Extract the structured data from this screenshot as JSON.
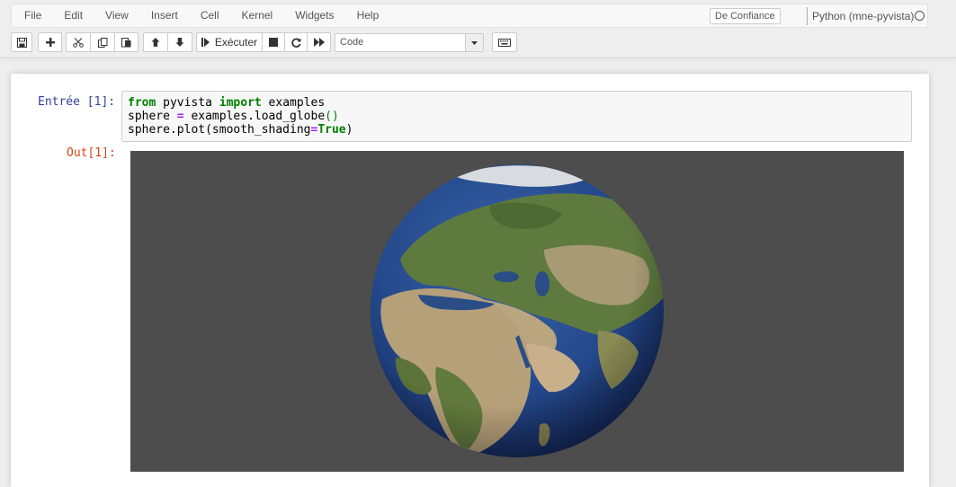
{
  "menu": {
    "items": [
      "File",
      "Edit",
      "View",
      "Insert",
      "Cell",
      "Kernel",
      "Widgets",
      "Help"
    ],
    "trusted_label": "De Confiance",
    "kernel_label": "Python (mne-pyvista)"
  },
  "toolbar": {
    "run_label": "Exécuter",
    "cell_type": "Code",
    "buttons": [
      "save",
      "add-cell",
      "cut",
      "copy",
      "paste",
      "move-up",
      "move-down",
      "run",
      "interrupt",
      "restart",
      "restart-run-all",
      "command-palette"
    ]
  },
  "cell": {
    "in_prompt": "Entrée [1]:",
    "out_prompt": "Out[1]:",
    "code": {
      "line1": {
        "kw1": "from",
        "t1": " pyvista ",
        "kw2": "import",
        "t2": " examples"
      },
      "line2": {
        "t1": "sphere ",
        "op": "=",
        "t2": " examples.load_globe",
        "par": "()"
      },
      "line3": {
        "t1": "sphere.plot(smooth_shading",
        "op": "=",
        "kw": "True",
        "t2": ")"
      }
    }
  },
  "colors": {
    "in_prompt": "#303f9f",
    "out_prompt": "#d84315",
    "keyword": "#008000",
    "operator": "#aa22ff",
    "render_bg": "#4d4d4d",
    "ocean": "#1f3f78"
  },
  "render": {
    "content": "globe-earth-africa-europe-asia"
  }
}
